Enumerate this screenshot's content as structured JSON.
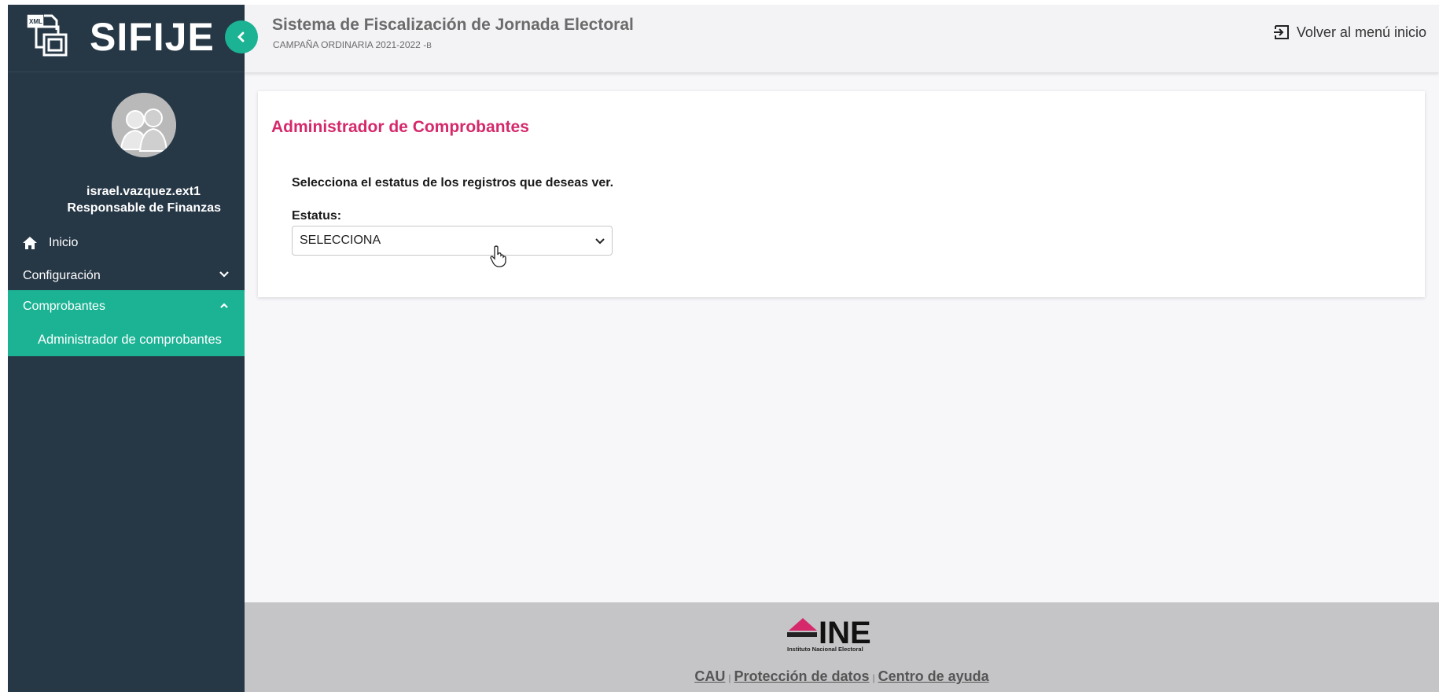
{
  "app": {
    "logo_text": "SIFIJE",
    "logo_badge": "XML"
  },
  "header": {
    "title": "Sistema de Fiscalización de Jornada Electoral",
    "subtitle": "CAMPAÑA ORDINARIA 2021-2022 -",
    "subtitle_suffix": "B",
    "back_label": "Volver al menú inicio"
  },
  "sidebar": {
    "user_name": "israel.vazquez.ext1",
    "user_role": "Responsable de Finanzas",
    "items": [
      {
        "label": "Inicio"
      },
      {
        "label": "Configuración"
      },
      {
        "label": "Comprobantes"
      },
      {
        "label": "Administrador de comprobantes"
      }
    ]
  },
  "main": {
    "title": "Administrador de Comprobantes",
    "instruction": "Selecciona el estatus de los registros que deseas ver.",
    "status_label": "Estatus:",
    "status_value": "SELECCIONA"
  },
  "footer": {
    "logo_text": "INE",
    "logo_caption": "Instituto Nacional Electoral",
    "links": [
      "CAU",
      "Protección de datos",
      "Centro de ayuda"
    ],
    "separator": "|"
  },
  "colors": {
    "sidebar_bg": "#263746",
    "accent_green": "#1bb394",
    "title_pink": "#d5296b",
    "footer_bg": "#c5c4c7"
  }
}
